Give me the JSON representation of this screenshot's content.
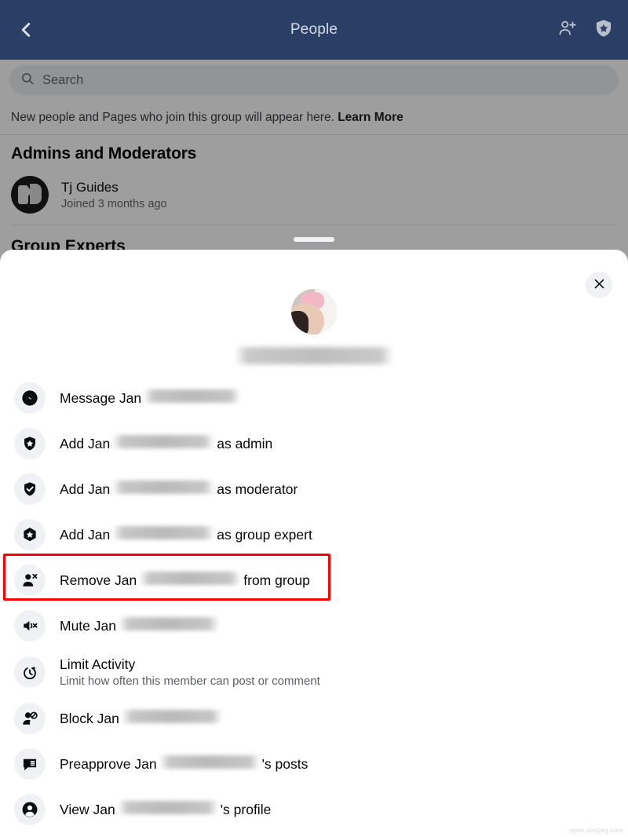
{
  "header": {
    "title": "People",
    "back_icon": "chevron-left-icon",
    "add_member_icon": "add-person-icon",
    "admin_shield_icon": "shield-star-icon"
  },
  "search": {
    "placeholder": "Search",
    "icon": "search-icon"
  },
  "notice": {
    "text": "New people and Pages who join this group will appear here.",
    "link": "Learn More"
  },
  "sections": {
    "admins_title": "Admins and Moderators",
    "group_experts_title": "Group Experts"
  },
  "admin_person": {
    "name": "Tj Guides",
    "subtitle": "Joined 3 months ago"
  },
  "sheet": {
    "close_icon": "close-icon",
    "drag_handle": "drag-handle",
    "avatar": "member-avatar",
    "member_name_redacted": "",
    "items": [
      {
        "id": "message",
        "icon": "messenger-icon",
        "prefix": "Message Jan",
        "redacted": true,
        "redact_width": 123,
        "suffix": "",
        "subtitle": ""
      },
      {
        "id": "add-admin",
        "icon": "shield-star-icon",
        "prefix": "Add Jan",
        "redacted": true,
        "redact_width": 130,
        "suffix": "as admin",
        "subtitle": ""
      },
      {
        "id": "add-moderator",
        "icon": "shield-check-icon",
        "prefix": "Add Jan",
        "redacted": true,
        "redact_width": 130,
        "suffix": "as moderator",
        "subtitle": ""
      },
      {
        "id": "add-group-expert",
        "icon": "hexagon-star-icon",
        "prefix": "Add Jan",
        "redacted": true,
        "redact_width": 130,
        "suffix": "as group expert",
        "subtitle": ""
      },
      {
        "id": "remove-from-group",
        "icon": "person-remove-icon",
        "prefix": "Remove Jan",
        "redacted": true,
        "redact_width": 130,
        "suffix": "from group",
        "subtitle": "",
        "highlighted": true
      },
      {
        "id": "mute",
        "icon": "speaker-mute-icon",
        "prefix": "Mute Jan",
        "redacted": true,
        "redact_width": 128,
        "suffix": "",
        "subtitle": ""
      },
      {
        "id": "limit-activity",
        "icon": "timer-icon",
        "prefix": "Limit Activity",
        "redacted": false,
        "redact_width": 0,
        "suffix": "",
        "subtitle": "Limit how often this member can post or comment"
      },
      {
        "id": "block",
        "icon": "person-block-icon",
        "prefix": "Block Jan",
        "redacted": true,
        "redact_width": 128,
        "suffix": "",
        "subtitle": ""
      },
      {
        "id": "preapprove-posts",
        "icon": "chat-lines-icon",
        "prefix": "Preapprove Jan",
        "redacted": true,
        "redact_width": 128,
        "suffix": "'s posts",
        "subtitle": ""
      },
      {
        "id": "view-profile",
        "icon": "person-circle-icon",
        "prefix": "View Jan",
        "redacted": true,
        "redact_width": 128,
        "suffix": "'s profile",
        "subtitle": ""
      }
    ]
  },
  "annotation": {
    "highlight_color": "#ff0000",
    "highlight_target": "remove-from-group"
  },
  "watermark": "www.dexpag.com",
  "colors": {
    "topbar": "#2b3f66",
    "sheet_bg": "#ffffff",
    "icon_bg": "#eff1f4",
    "scrim": "rgba(0,0,0,0.38)"
  }
}
